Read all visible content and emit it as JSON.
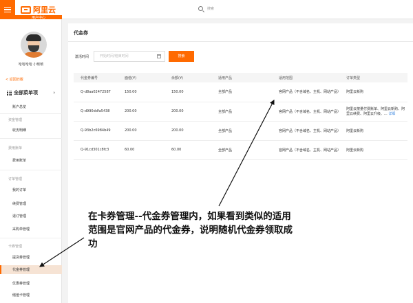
{
  "header": {
    "logo_text": "阿里云",
    "logo_sub": "用户中心",
    "search_placeholder": "搜索"
  },
  "sidebar": {
    "username": "哈哈哈哈 小敏敏",
    "back_label": "< 返回旧版",
    "all_menu_label": "全部菜单项",
    "items": {
      "account_overview": "账户总览",
      "funds_group": "资金管理",
      "income_expense": "收支明细",
      "billing_group": "费用账单",
      "billing_detail": "费用账单",
      "orders_group": "订单管理",
      "my_orders": "我的订单",
      "renewal": "续费管理",
      "refund": "退订管理",
      "purchase_orders": "采购单管理",
      "cards_group": "卡券管理",
      "voucher": "提货券管理",
      "coupon_voucher": "代金券管理",
      "discount": "优惠券管理",
      "storage_card": "储值卡管理"
    }
  },
  "main": {
    "page_title": "代金券",
    "filter_label": "激活时间",
    "date_placeholder": "开始时间/结束时间",
    "search_button": "搜索",
    "columns": [
      "代金券编号",
      "面值(¥)",
      "余额(¥)",
      "适用产品",
      "适用范围",
      "订单类型"
    ],
    "rows": [
      [
        "Q-d8aa02472587",
        "150.00",
        "150.00",
        "全部产品",
        "官网产品（不含域名、主机、网站产品）",
        "阿里云新购"
      ],
      [
        "Q-d990ddfa5438",
        "200.00",
        "200.00",
        "全部产品",
        "官网产品（不含域名、主机、网站产品）",
        "阿里云按量付费账单、阿里云新购、阿里云续费、阿里云升级、..."
      ],
      [
        "Q-93b2c6984b49",
        "200.00",
        "200.00",
        "全部产品",
        "官网产品（不含域名、主机、网站产品）",
        "阿里云新购"
      ],
      [
        "Q-91cd301c8fc3",
        "60.00",
        "60.00",
        "全部产品",
        "官网产品（不含域名、主机、网站产品）",
        "阿里云新购"
      ]
    ],
    "more_label": "详细"
  },
  "annotation": {
    "text": "在卡券管理--代金券管理内，如果看到类似的适用范围是官网产品的代金券，说明随机代金券领取成功"
  },
  "colors": {
    "accent": "#ff6a00"
  }
}
